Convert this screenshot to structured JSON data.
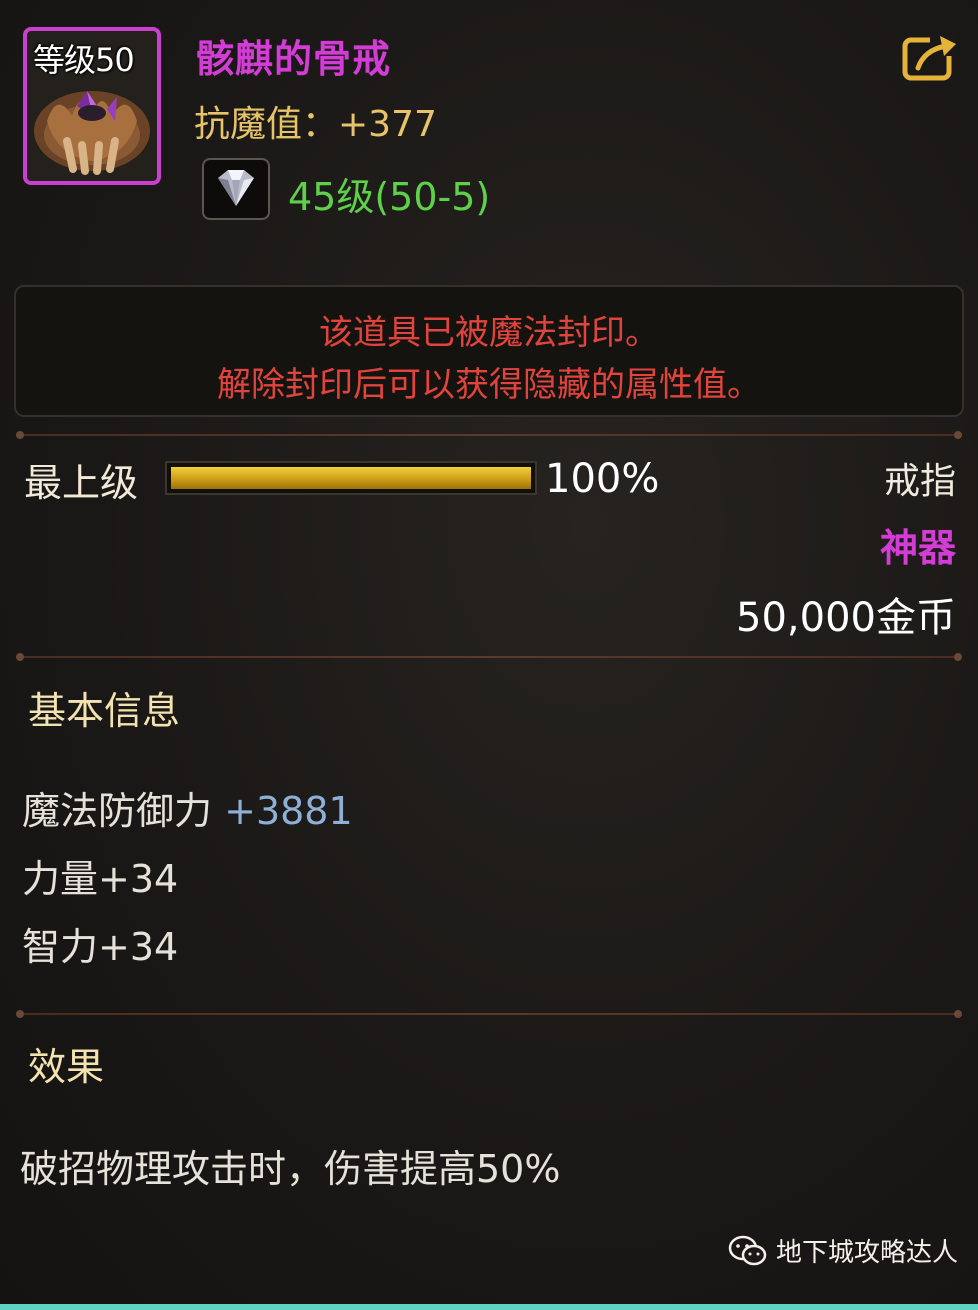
{
  "item": {
    "level_badge": "等级50",
    "name": "骸麒的骨戒",
    "stat_line": "抗魔值：+377",
    "gem_level": "45级(50-5)"
  },
  "seal": {
    "line1": "该道具已被魔法封印。",
    "line2": "解除封印后可以获得隐藏的属性值。"
  },
  "grade": {
    "label": "最上级",
    "percent_text": "100%",
    "percent_value": 100
  },
  "meta": {
    "type": "戒指",
    "rarity": "神器",
    "price": "50,000金币"
  },
  "basic_info": {
    "title": "基本信息",
    "attr1_name": "魔法防御力",
    "attr1_value": "+3881",
    "attr2": "力量+34",
    "attr3": "智力+34"
  },
  "effect": {
    "title": "效果",
    "text": "破招物理攻击时，伤害提高50%"
  },
  "watermark": "地下城攻略达人",
  "colors": {
    "name": "#d43cd6",
    "stat": "#e7c46a",
    "gem_level": "#5ed04a",
    "seal_text": "#e0443c",
    "attr_value": "#8fb0d6"
  }
}
